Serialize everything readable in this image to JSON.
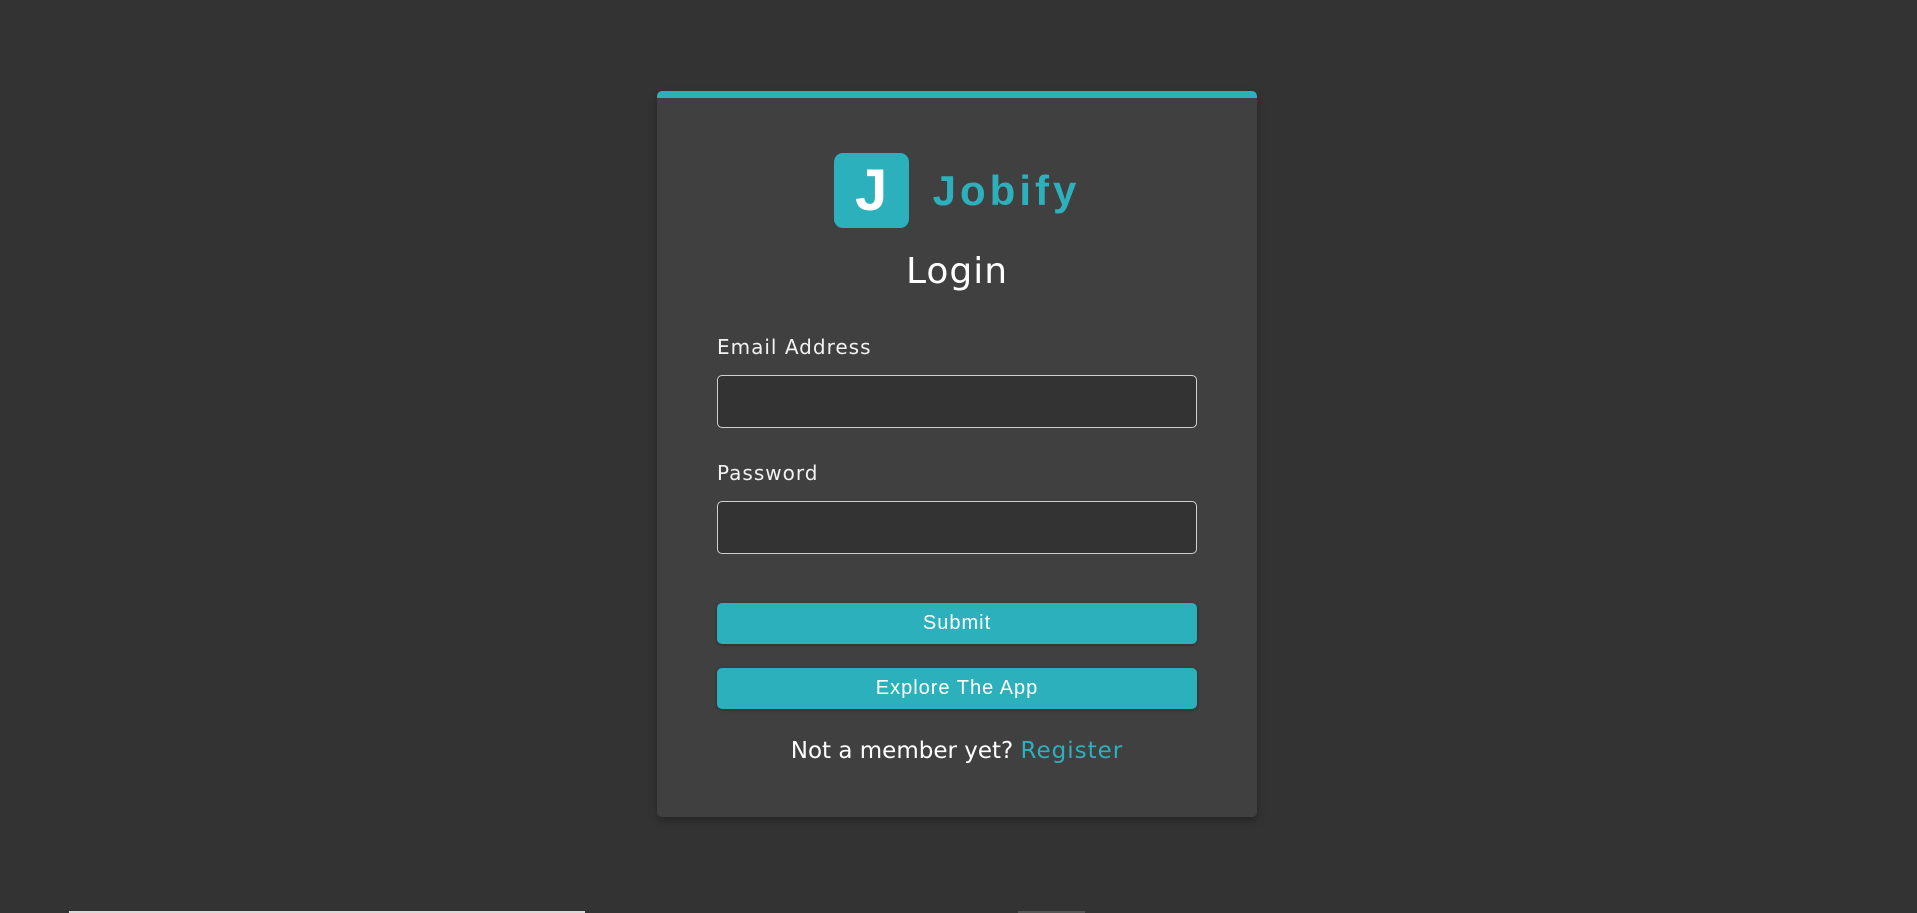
{
  "brand": {
    "logo_letter": "J",
    "name": "Jobify"
  },
  "form": {
    "title": "Login",
    "email_label": "Email Address",
    "email_value": "",
    "password_label": "Password",
    "password_value": "",
    "submit_label": "Submit",
    "explore_label": "Explore The App"
  },
  "footer": {
    "prompt": "Not a member yet?",
    "register_label": "Register"
  },
  "colors": {
    "background": "#333333",
    "card": "#404040",
    "accent": "#2cb1bc",
    "text": "#ffffff"
  }
}
